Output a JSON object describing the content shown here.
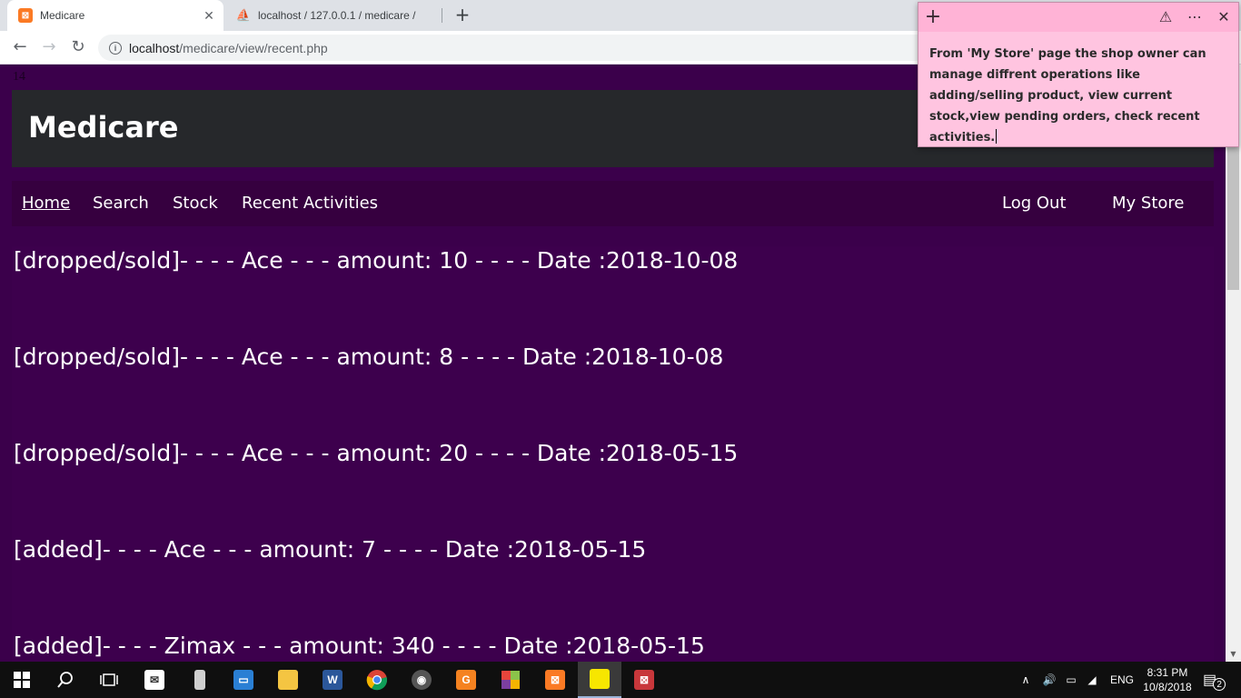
{
  "browser": {
    "tabs": [
      {
        "title": "Medicare",
        "icon": "xampp-icon"
      },
      {
        "title": "localhost / 127.0.0.1 / medicare /",
        "icon": "phpmyadmin-icon"
      }
    ],
    "url_host": "localhost",
    "url_path": "/medicare/view/recent.php"
  },
  "page": {
    "counter": "14",
    "site_title": "Medicare",
    "nav": {
      "home": "Home",
      "search": "Search",
      "stock": "Stock",
      "recent": "Recent Activities",
      "logout": "Log Out",
      "mystore": "My Store"
    },
    "activities": [
      "[dropped/sold]- - - - Ace - - - amount: 10 - - - - Date :2018-10-08",
      "[dropped/sold]- - - - Ace - - - amount: 8 - - - - Date :2018-10-08",
      "[dropped/sold]- - - - Ace - - - amount: 20 - - - - Date :2018-05-15",
      "[added]- - - - Ace - - - amount: 7 - - - - Date :2018-05-15",
      "[added]- - - - Zimax - - - amount: 340 - - - - Date :2018-05-15"
    ]
  },
  "sticky_note": {
    "text": "From 'My Store' page the shop owner can manage diffrent operations like adding/selling product, view current stock,view pending orders, check recent activities."
  },
  "taskbar": {
    "time": "8:31 PM",
    "date": "10/8/2018",
    "language": "ENG",
    "notification_count": "2"
  },
  "colors": {
    "page_bg": "#3b004b",
    "header_bg": "#26282b",
    "sticky_bg": "#ffc4e0"
  }
}
